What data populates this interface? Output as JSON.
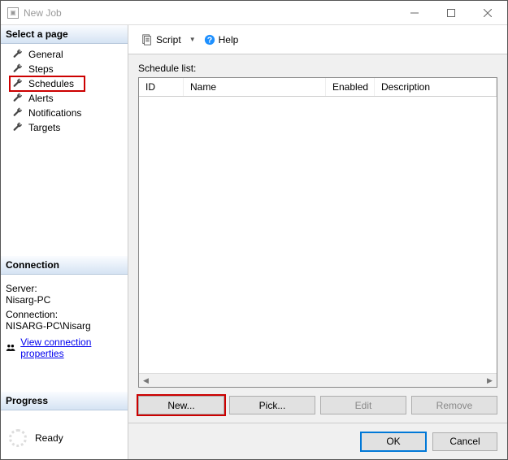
{
  "window": {
    "title": "New Job"
  },
  "sidebar": {
    "header": "Select a page",
    "items": [
      {
        "label": "General"
      },
      {
        "label": "Steps"
      },
      {
        "label": "Schedules"
      },
      {
        "label": "Alerts"
      },
      {
        "label": "Notifications"
      },
      {
        "label": "Targets"
      }
    ]
  },
  "connection": {
    "header": "Connection",
    "server_label": "Server:",
    "server_value": "Nisarg-PC",
    "connection_label": "Connection:",
    "connection_value": "NISARG-PC\\Nisarg",
    "link": "View connection properties"
  },
  "progress": {
    "header": "Progress",
    "status": "Ready"
  },
  "toolbar": {
    "script": "Script",
    "help": "Help"
  },
  "content": {
    "list_label": "Schedule list:",
    "columns": {
      "id": "ID",
      "name": "Name",
      "enabled": "Enabled",
      "desc": "Description"
    },
    "buttons": {
      "new": "New...",
      "pick": "Pick...",
      "edit": "Edit",
      "remove": "Remove"
    }
  },
  "footer": {
    "ok": "OK",
    "cancel": "Cancel"
  }
}
